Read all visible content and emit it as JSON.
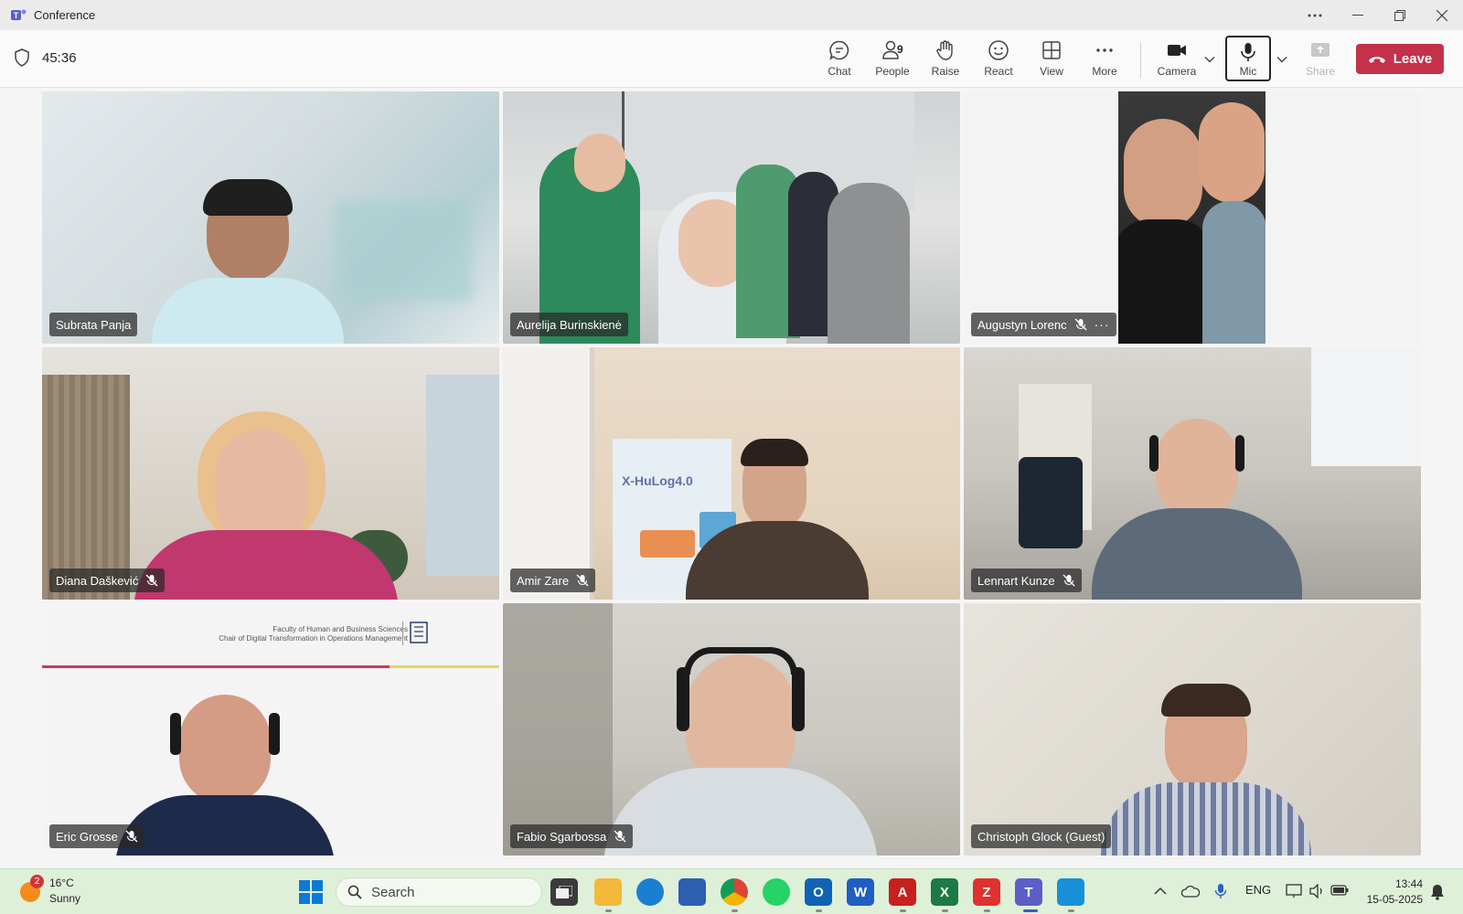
{
  "window": {
    "title": "Conference"
  },
  "toolbar": {
    "timer": "45:36",
    "chat": "Chat",
    "people": "People",
    "people_count": "9",
    "raise": "Raise",
    "react": "React",
    "view": "View",
    "more": "More",
    "camera": "Camera",
    "mic": "Mic",
    "share": "Share",
    "leave": "Leave"
  },
  "participants": [
    {
      "name": "Subrata Panja",
      "muted": false
    },
    {
      "name": "Aurelija Burinskienė",
      "muted": false
    },
    {
      "name": "Augustyn Lorenc",
      "muted": true
    },
    {
      "name": "Diana Daškević",
      "muted": true
    },
    {
      "name": "Amir Zare",
      "muted": true
    },
    {
      "name": "Lennart Kunze",
      "muted": true
    },
    {
      "name": "Eric Grosse",
      "muted": true
    },
    {
      "name": "Fabio Sgarbossa",
      "muted": true
    },
    {
      "name": "Christoph Glock (Guest)",
      "muted": false
    }
  ],
  "tiles_text": {
    "background_logo": "X-HuLog4.0",
    "slide_line1": "Faculty of Human and Business Sciences",
    "slide_line2": "Chair of Digital Transformation in Operations Management"
  },
  "taskbar": {
    "weather_badge": "2",
    "temperature": "16°C",
    "condition": "Sunny",
    "search_placeholder": "Search",
    "language": "ENG",
    "time": "13:44",
    "date": "15-05-2025"
  },
  "colors": {
    "leave": "#c4314b",
    "teams_purple": "#5b5fc7",
    "taskbar": "#dff0d8"
  }
}
